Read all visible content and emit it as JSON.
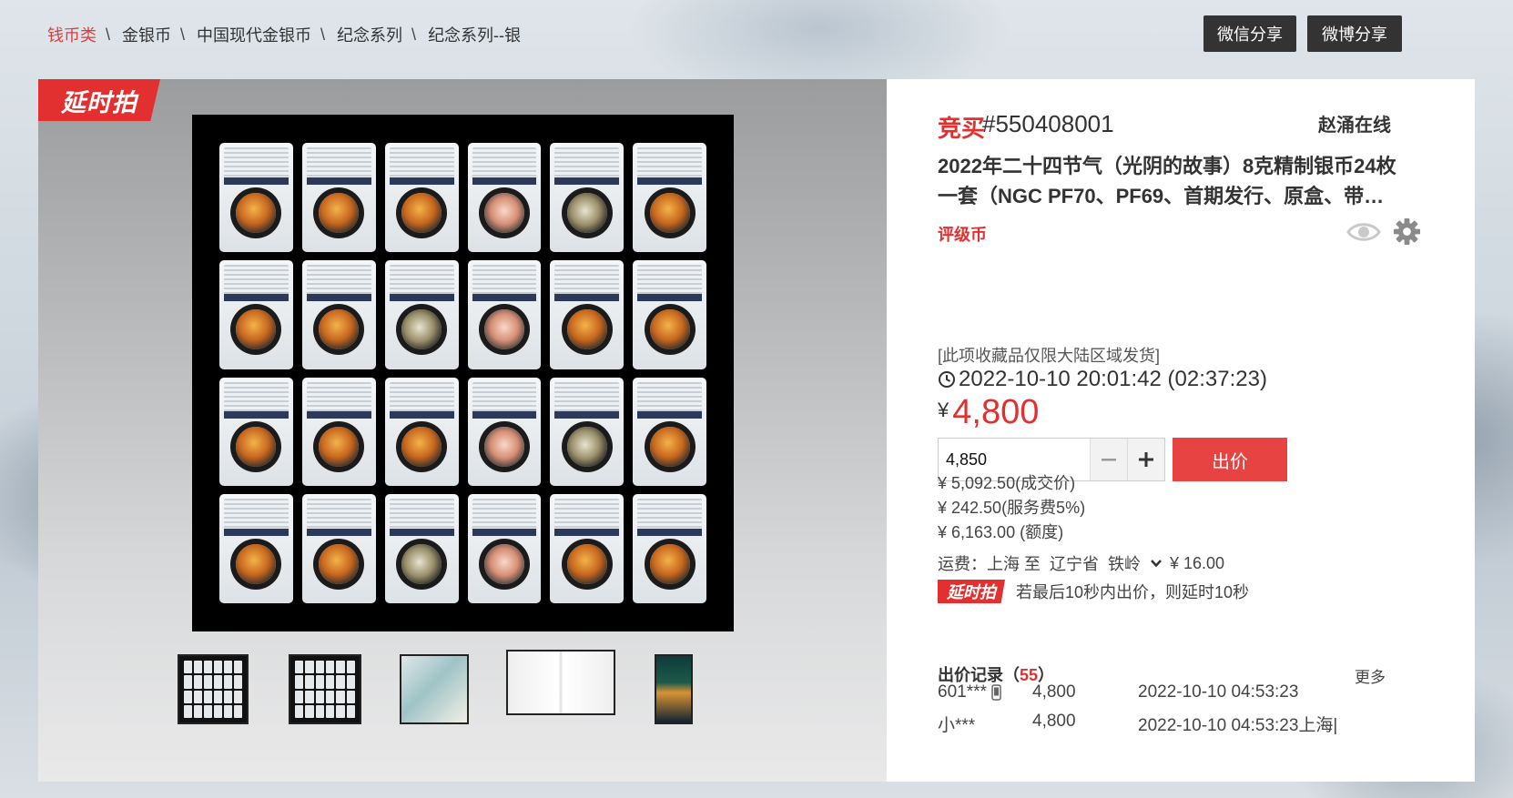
{
  "breadcrumb": [
    "钱币类",
    "金银币",
    "中国现代金银币",
    "纪念系列",
    "纪念系列--银"
  ],
  "breadcrumb_separator": "\\",
  "share": {
    "wechat": "微信分享",
    "weibo": "微博分享"
  },
  "badge": "延时拍",
  "lot": {
    "type_label": "竞买",
    "number": "#550408001",
    "online_user": "赵涌在线",
    "title_line1": "2022年二十四节气（光阴的故事）8克精制银币24枚",
    "title_line2": "一套（NGC PF70、PF69、首期发行、原盒、带…",
    "category": "评级币",
    "icons": [
      "eye-icon",
      "gear-icon"
    ]
  },
  "auction": {
    "notice": "[此项收藏品仅限大陆区域发货]",
    "end_time": "2022-10-10 20:01:42 (02:37:23)",
    "currency": "¥",
    "current_price": "4,800",
    "bid_input_value": "4,850",
    "bid_button": "出价",
    "deal_price": "¥ 5,092.50(成交价)",
    "service_fee": "¥ 242.50(服务费5%)",
    "quota": "¥ 6,163.00 (额度)",
    "shipping": {
      "label": "运费：上海 至",
      "province": "辽宁省",
      "city": "铁岭",
      "cost": "¥ 16.00"
    },
    "extension_badge": "延时拍",
    "extension_text": "若最后10秒内出价，则延时10秒"
  },
  "records": {
    "title": "出价记录",
    "count_open": "（",
    "count": "55",
    "count_close": "）",
    "more": "更多",
    "rows": [
      {
        "user": "601***",
        "amount": "4,800",
        "time": "2022-10-10 04:53:23"
      },
      {
        "user": "小***",
        "amount": "4,800",
        "time": "2022-10-10 04:53:23上海|"
      }
    ]
  },
  "colors": {
    "accent": "#e23030",
    "dark_button": "#333333"
  }
}
